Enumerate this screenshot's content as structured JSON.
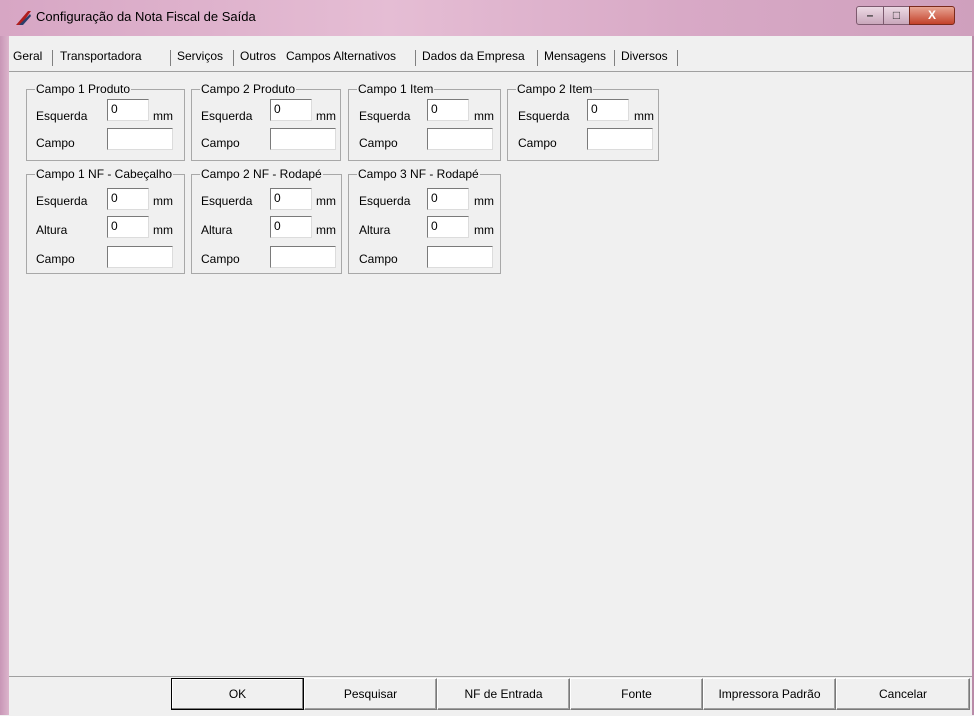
{
  "window": {
    "title": "Configuração da Nota Fiscal de Saída",
    "controls": {
      "minimize": "–",
      "maximize": "□",
      "close": "X"
    }
  },
  "tabs": [
    {
      "label": "Geral",
      "active": false
    },
    {
      "label": "Transportadora",
      "active": false
    },
    {
      "label": "Serviços",
      "active": false
    },
    {
      "label": "Outros",
      "active": false
    },
    {
      "label": "Campos Alternativos",
      "active": true
    },
    {
      "label": "Dados da Empresa",
      "active": false
    },
    {
      "label": "Mensagens",
      "active": false
    },
    {
      "label": "Diversos",
      "active": false
    }
  ],
  "labels": {
    "esquerda": "Esquerda",
    "altura": "Altura",
    "campo": "Campo",
    "mm": "mm"
  },
  "groups": {
    "campo1_produto": {
      "title": "Campo 1 Produto",
      "esquerda": "0",
      "campo": ""
    },
    "campo2_produto": {
      "title": "Campo 2 Produto",
      "esquerda": "0",
      "campo": ""
    },
    "campo1_item": {
      "title": "Campo 1 Item",
      "esquerda": "0",
      "campo": ""
    },
    "campo2_item": {
      "title": "Campo 2 Item",
      "esquerda": "0",
      "campo": ""
    },
    "campo1_nf_cabecalho": {
      "title": "Campo 1 NF - Cabeçalho",
      "esquerda": "0",
      "altura": "0",
      "campo": ""
    },
    "campo2_nf_rodape": {
      "title": "Campo 2 NF - Rodapé",
      "esquerda": "0",
      "altura": "0",
      "campo": ""
    },
    "campo3_nf_rodape": {
      "title": "Campo 3 NF - Rodapé",
      "esquerda": "0",
      "altura": "0",
      "campo": ""
    }
  },
  "buttons": {
    "ok": "OK",
    "pesquisar": "Pesquisar",
    "nf_entrada": "NF de Entrada",
    "fonte": "Fonte",
    "impressora": "Impressora Padrão",
    "cancelar": "Cancelar"
  },
  "colors": {
    "titlebar": "#d9a9c7",
    "close_button": "#c3412a",
    "window_bg": "#f0f0f0"
  }
}
